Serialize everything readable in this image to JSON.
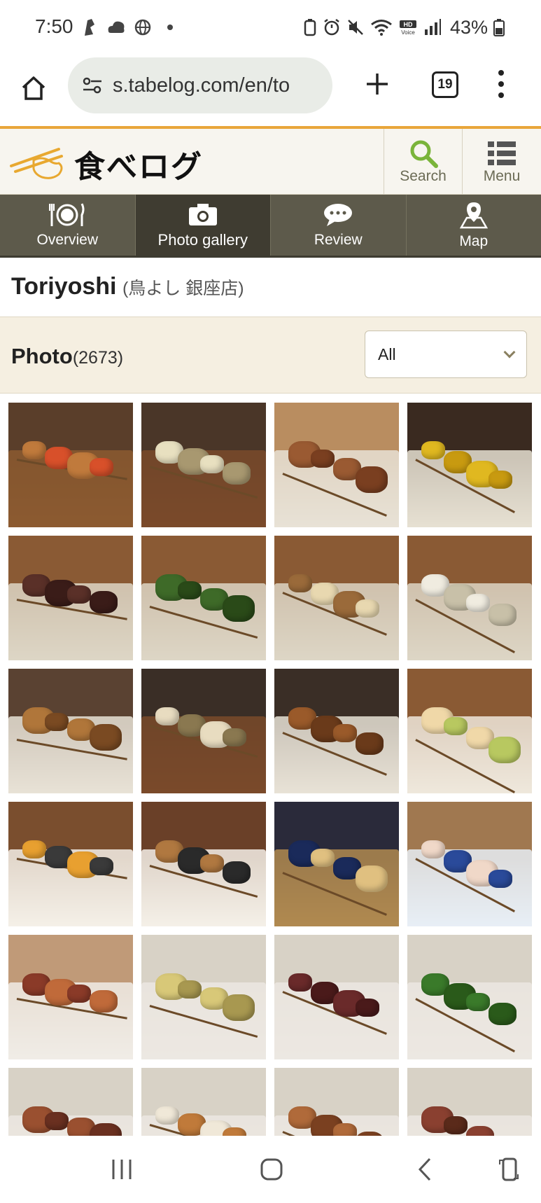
{
  "status": {
    "time": "7:50",
    "battery": "43%"
  },
  "browser": {
    "url": "s.tabelog.com/en/to",
    "tab_count": "19"
  },
  "header": {
    "logo_text": "食べログ",
    "search_label": "Search",
    "menu_label": "Menu"
  },
  "tabs": [
    {
      "label": "Overview",
      "icon": "utensils-icon"
    },
    {
      "label": "Photo gallery",
      "icon": "camera-icon",
      "active": true
    },
    {
      "label": "Review",
      "icon": "chat-bubble-icon"
    },
    {
      "label": "Map",
      "icon": "map-pin-icon"
    }
  ],
  "restaurant": {
    "name": "Toriyoshi",
    "subtitle": "(鳥よし 銀座店)"
  },
  "photos": {
    "label": "Photo",
    "count": "(2673)",
    "filter_selected": "All"
  },
  "gallery": [
    {
      "alt": "skewer-with-tomato",
      "bg": "#5a3e2a",
      "plate": "#8c5a30",
      "food": "#c07a3c",
      "accent": "#d8502a"
    },
    {
      "alt": "leek-skewer",
      "bg": "#4a3628",
      "plate": "#7a4a2a",
      "food": "#e8e0c0",
      "accent": "#a89870"
    },
    {
      "alt": "chicken-skewer-plate",
      "bg": "#b98d60",
      "plate": "#e8e2d6",
      "food": "#9a5a32",
      "accent": "#7a3f20"
    },
    {
      "alt": "ginkgo-skewer",
      "bg": "#3a2a20",
      "plate": "#e6e0d2",
      "food": "#e0b820",
      "accent": "#c89a10"
    },
    {
      "alt": "liver-skewer",
      "bg": "#8a5a34",
      "plate": "#ddd6c6",
      "food": "#5a3028",
      "accent": "#3a1c18"
    },
    {
      "alt": "shishito-skewer",
      "bg": "#8a5a34",
      "plate": "#ddd6c6",
      "food": "#3e6a28",
      "accent": "#2a4a18"
    },
    {
      "alt": "tofu-skewer",
      "bg": "#8a5a34",
      "plate": "#ddd6c6",
      "food": "#9a6a3a",
      "accent": "#e8d8b0"
    },
    {
      "alt": "quail-egg-skewer",
      "bg": "#8a5a34",
      "plate": "#ddd6c6",
      "food": "#f0ece0",
      "accent": "#c8c0a8"
    },
    {
      "alt": "thigh-skewer",
      "bg": "#5a4232",
      "plate": "#e8e2d6",
      "food": "#b0763a",
      "accent": "#7a4a22"
    },
    {
      "alt": "leek-closeup",
      "bg": "#3a2e26",
      "plate": "#7a4a2a",
      "food": "#e8dcc0",
      "accent": "#8a7850"
    },
    {
      "alt": "tsukune-skewer",
      "bg": "#3a2e26",
      "plate": "#e8e2d6",
      "food": "#9a5a2a",
      "accent": "#6a3a1a"
    },
    {
      "alt": "wasabi-chicken",
      "bg": "#8a5a34",
      "plate": "#eee8dc",
      "food": "#f0d8a8",
      "accent": "#b8c860"
    },
    {
      "alt": "oyakodon-bowl",
      "bg": "#7a4e2e",
      "plate": "#f4f0e8",
      "food": "#e8a030",
      "accent": "#3a3a3a"
    },
    {
      "alt": "soboro-bowl",
      "bg": "#6a4028",
      "plate": "#f4f0e8",
      "food": "#b07840",
      "accent": "#2a2a2a"
    },
    {
      "alt": "storefront",
      "bg": "#2a2a3a",
      "plate": "#b08a50",
      "food": "#1a2a5a",
      "accent": "#e0c080"
    },
    {
      "alt": "chicken-sashimi",
      "bg": "#a07850",
      "plate": "#e8eef6",
      "food": "#f0d8c8",
      "accent": "#2a4a9a"
    },
    {
      "alt": "two-skewers",
      "bg": "#c09a78",
      "plate": "#f0ece6",
      "food": "#8a3a28",
      "accent": "#c06a3a"
    },
    {
      "alt": "ginkgo-skewer-2",
      "bg": "#d8d2c6",
      "plate": "#ece8e2",
      "food": "#d8c878",
      "accent": "#a89850"
    },
    {
      "alt": "heart-skewer",
      "bg": "#d8d2c6",
      "plate": "#ece8e2",
      "food": "#6a2a2a",
      "accent": "#4a1a1a"
    },
    {
      "alt": "asparagus-skewer",
      "bg": "#d8d2c6",
      "plate": "#ece8e2",
      "food": "#3a7a2a",
      "accent": "#2a5a1a"
    },
    {
      "alt": "skewer-row6-a",
      "bg": "#d8d2c6",
      "plate": "#ece8e2",
      "food": "#9a5030",
      "accent": "#6a3020"
    },
    {
      "alt": "skewer-row6-b",
      "bg": "#d8d2c6",
      "plate": "#ece8e2",
      "food": "#f0e8d8",
      "accent": "#c07a3a"
    },
    {
      "alt": "skewer-row6-c",
      "bg": "#d8d2c6",
      "plate": "#ece8e2",
      "food": "#b06a3a",
      "accent": "#7a4020"
    },
    {
      "alt": "skewer-row6-d",
      "bg": "#d8d2c6",
      "plate": "#ece8e2",
      "food": "#8a4030",
      "accent": "#5a2a1a"
    }
  ],
  "colors": {
    "header_accent": "#e9a63a",
    "tab_bg": "#5d5a4b",
    "tab_active_bg": "#3f3c31",
    "search_icon": "#7ab43a"
  }
}
